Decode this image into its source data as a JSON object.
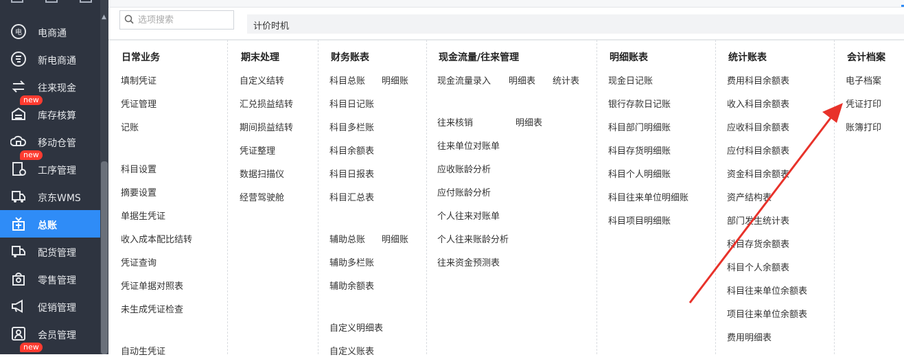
{
  "sidebar": {
    "items": [
      {
        "label": "电商通",
        "icon": "ecommerce-icon"
      },
      {
        "label": "新电商通",
        "icon": "new-ecommerce-icon"
      },
      {
        "label": "往来现金",
        "icon": "exchange-icon"
      },
      {
        "label": "库存核算",
        "icon": "warehouse-icon",
        "badge": "new"
      },
      {
        "label": "移动仓管",
        "icon": "mobile-warehouse-icon"
      },
      {
        "label": "工序管理",
        "icon": "process-icon",
        "badge": "new"
      },
      {
        "label": "京东WMS",
        "icon": "truck-icon"
      },
      {
        "label": "总账",
        "icon": "ledger-icon",
        "active": true
      },
      {
        "label": "配货管理",
        "icon": "delivery-icon"
      },
      {
        "label": "零售管理",
        "icon": "retail-icon"
      },
      {
        "label": "促销管理",
        "icon": "megaphone-icon"
      },
      {
        "label": "会员管理",
        "icon": "member-icon"
      }
    ],
    "bottom_badge": "new"
  },
  "toolbar": {
    "search_placeholder": "选项搜索",
    "pricing_label": "计价时机"
  },
  "columns": {
    "daily": {
      "title": "日常业务",
      "items": [
        "填制凭证",
        "凭证管理",
        "记账",
        "科目设置",
        "摘要设置",
        "单据生凭证",
        "收入成本配比结转",
        "凭证查询",
        "凭证单据对照表",
        "未生成凭证检查",
        "自动生凭证"
      ]
    },
    "period_end": {
      "title": "期末处理",
      "items": [
        "自定义结转",
        "汇兑损益结转",
        "期间损益结转",
        "凭证整理",
        "数据扫描仪",
        "经营驾驶舱"
      ]
    },
    "finance": {
      "title": "财务账表",
      "items": [
        "科目总账",
        "明细账",
        "科目日记账",
        "科目多栏账",
        "科目余额表",
        "科目日报表",
        "科目汇总表",
        "辅助总账",
        "明细账",
        "辅助多栏账",
        "辅助余额表",
        "自定义明细表",
        "自定义账表"
      ]
    },
    "cashflow": {
      "title": "现金流量/往来管理",
      "items": [
        "现金流量录入",
        "明细表",
        "统计表",
        "往来核销",
        "明细表",
        "往来单位对账单",
        "应收账龄分析",
        "应付账龄分析",
        "个人往来对账单",
        "个人往来账龄分析",
        "往来资金预测表"
      ]
    },
    "detail": {
      "title": "明细账表",
      "items": [
        "现金日记账",
        "银行存款日记账",
        "科目部门明细账",
        "科目存货明细账",
        "科目个人明细账",
        "科目往来单位明细账",
        "科目项目明细账"
      ]
    },
    "stats": {
      "title": "统计账表",
      "items": [
        "费用科目余额表",
        "收入科目余额表",
        "应收科目余额表",
        "应付科目余额表",
        "资金科目余额表",
        "资产结构表",
        "部门发生统计表",
        "科目存货余额表",
        "科目个人余额表",
        "科目往来单位余额表",
        "项目往来单位余额表",
        "费用明细表"
      ]
    },
    "archive": {
      "title": "会计档案",
      "items": [
        "电子档案",
        "凭证打印",
        "账簿打印"
      ]
    }
  },
  "colors": {
    "sidebar_bg": "#2e3440",
    "active_blue": "#2f8cf7",
    "annotation_red": "#e8322a"
  }
}
